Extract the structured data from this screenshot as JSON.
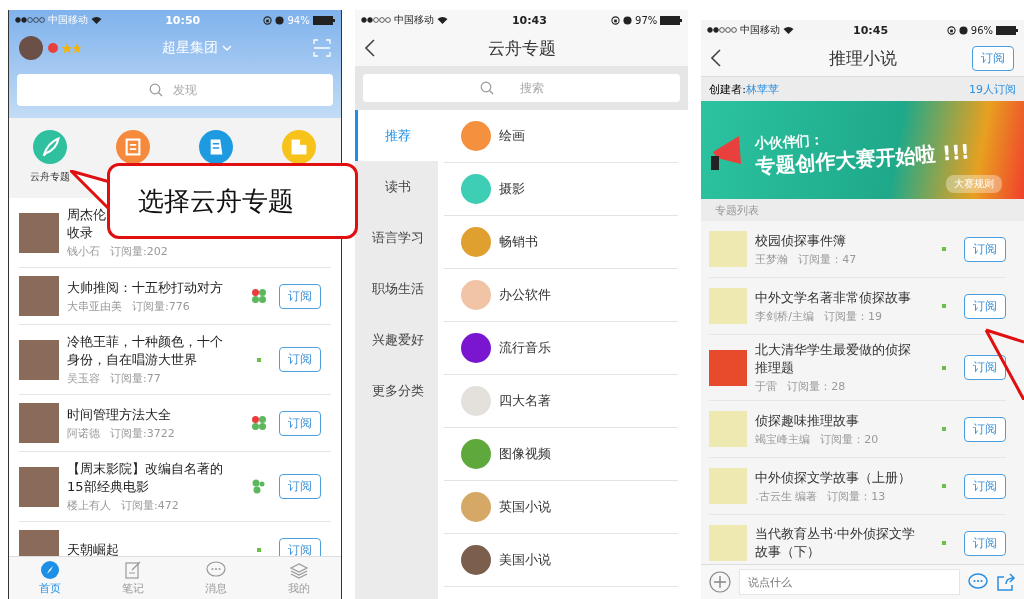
{
  "screens": [
    {
      "status_bar": {
        "carrier": "中国移动",
        "time": "10:50",
        "battery": "94%"
      },
      "header": {
        "title": "超星集团"
      },
      "search": {
        "placeholder": "发现"
      },
      "shortcuts": [
        {
          "label": "云舟专题",
          "color": "#2fc0a0"
        },
        {
          "color": "#f58a3c"
        },
        {
          "color": "#1e9be0"
        },
        {
          "color": "#f7c21a"
        }
      ],
      "topics": [
        {
          "lines": [
            "周杰伦",
            "收录"
          ],
          "author": "钱小石",
          "subs": "订阅量:202"
        },
        {
          "lines": [
            "大帅推阅：十五秒打动对方"
          ],
          "author": "大串亚由美",
          "subs": "订阅量:776",
          "badge": {
            "kind": "clover"
          },
          "button": "订阅"
        },
        {
          "lines": [
            "冷艳王菲，十种颜色，十个",
            "身份，自在唱游大世界"
          ],
          "author": "吴玉容",
          "subs": "订阅量:77",
          "badge": {
            "kind": "dot"
          },
          "button": "订阅"
        },
        {
          "lines": [
            "时间管理方法大全"
          ],
          "author": "阿诺德",
          "subs": "订阅量:3722",
          "badge": {
            "kind": "clover"
          },
          "button": "订阅"
        },
        {
          "lines": [
            "【周末影院】改编自名著的",
            "15部经典电影"
          ],
          "author": "楼上有人",
          "subs": "订阅量:472",
          "badge": {
            "kind": "leaf"
          },
          "button": "订阅"
        },
        {
          "lines": [
            "天朝崛起"
          ],
          "badge": {
            "kind": "dot"
          },
          "button": "订阅"
        }
      ],
      "tabs": [
        {
          "label": "首页",
          "selected": true
        },
        {
          "label": "笔记",
          "selected": false
        },
        {
          "label": "消息",
          "selected": false
        },
        {
          "label": "我的",
          "selected": false
        }
      ]
    },
    {
      "status_bar": {
        "carrier": "中国移动",
        "time": "10:43",
        "battery": "97%"
      },
      "title": "云舟专题",
      "search": {
        "placeholder": "搜索"
      },
      "sidebar": [
        {
          "label": "推荐",
          "selected": true
        },
        {
          "label": "读书",
          "selected": false
        },
        {
          "label": "语言学习",
          "selected": false
        },
        {
          "label": "职场生活",
          "selected": false
        },
        {
          "label": "兴趣爱好",
          "selected": false
        },
        {
          "label": "更多分类",
          "selected": false
        }
      ],
      "categories": [
        {
          "label": "绘画",
          "color": "#f5913e"
        },
        {
          "label": "摄影",
          "color": "#3ecdb5"
        },
        {
          "label": "畅销书",
          "color": "#e0a030"
        },
        {
          "label": "办公软件",
          "color": "#f2c4a6"
        },
        {
          "label": "流行音乐",
          "color": "#7a16d0"
        },
        {
          "label": "四大名著",
          "color": "#e4e0dc"
        },
        {
          "label": "图像视频",
          "color": "#5ea83c"
        },
        {
          "label": "英国小说",
          "color": "#d6a866"
        },
        {
          "label": "美国小说",
          "color": "#7c5e4c"
        }
      ]
    },
    {
      "status_bar": {
        "carrier": "中国移动",
        "time": "10:45",
        "battery": "96%"
      },
      "title": "推理小说",
      "subscribe_button": "订阅",
      "creator_label": "创建者:",
      "creator": "林苹苹",
      "subscribers": "19人订阅",
      "banner": {
        "line1": "小伙伴们：",
        "line2": "专题创作大赛开始啦 !!!",
        "button": "大赛规则"
      },
      "section": "专题列表",
      "books": [
        {
          "lines": [
            "校园侦探事件簿"
          ],
          "author": "王梦瀚",
          "subs": "订阅量：47",
          "button": "订阅"
        },
        {
          "lines": [
            "中外文学名著非常侦探故事"
          ],
          "author": "李剑桥/主编",
          "subs": "订阅量：19",
          "button": "订阅"
        },
        {
          "lines": [
            "北大清华学生最爱做的侦探",
            "推理题"
          ],
          "author": "于雷",
          "subs": "订阅量：28",
          "button": "订阅"
        },
        {
          "lines": [
            "侦探趣味推理故事"
          ],
          "author": "竭宝峰主编",
          "subs": "订阅量：20",
          "button": "订阅"
        },
        {
          "lines": [
            "中外侦探文学故事（上册）"
          ],
          "author": ".古云生 编著",
          "subs": "订阅量：13",
          "button": "订阅"
        },
        {
          "lines": [
            "当代教育丛书·中外侦探文学",
            "故事（下）"
          ],
          "button": "订阅"
        }
      ],
      "comment": {
        "placeholder": "说点什么"
      }
    }
  ],
  "callout": {
    "text": "选择云舟专题"
  }
}
